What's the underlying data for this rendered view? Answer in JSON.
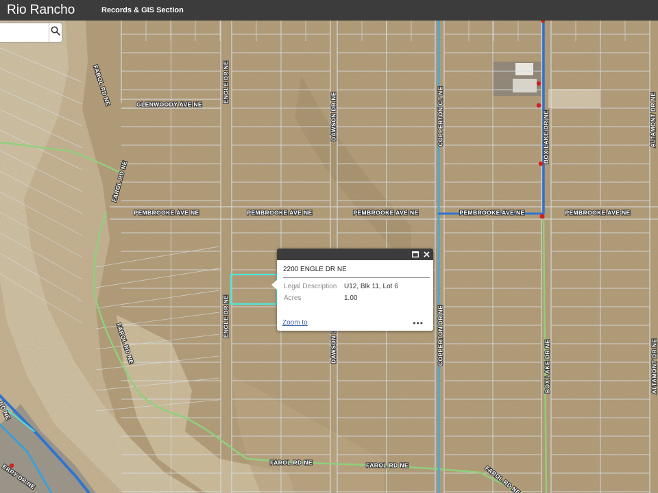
{
  "app": {
    "title": "Rio Rancho",
    "subtitle": "Records & GIS Section"
  },
  "search": {
    "value": "",
    "placeholder": "",
    "button_icon": "search-icon"
  },
  "map": {
    "imagery": "aerial-desert",
    "colors": {
      "parcel_lines": "#d6dde2",
      "road_green": "#8fd07c",
      "utility_blue": "#3a87d8",
      "highlight_cyan": "#4fe6d6",
      "hydrant_red": "#d11f1f"
    },
    "road_labels": [
      "FAROL RD NE",
      "GLENWOODY AVE NE",
      "ENGLE DR NE",
      "DAWSON DR NE",
      "COPPERTON CT NE",
      "BOX LAKE DR NE",
      "ALTAMONT DR NE",
      "FAROL RD NE",
      "PEMBROOKE AVE NE",
      "PEMBROOKE AVE NE",
      "PEMBROOKE AVE NE",
      "PEMBROOKE AVE NE",
      "PEMBROOKE AVE NE",
      "ENGLE DR NE",
      "FAROL RD NE",
      "DAWSON DR NE",
      "COPPERTON DR NE",
      "BOX LAKE DR NE",
      "ALTAMONT DR NE",
      "FAROL RD NE",
      "FAROL RD NE",
      "FAROL RD NE",
      "ERRY DR NE",
      "RD NE"
    ]
  },
  "popup": {
    "title": "2200 ENGLE DR NE",
    "attributes": [
      {
        "name": "Legal Description",
        "value": "U12, Blk 11, Lot 6"
      },
      {
        "name": "Acres",
        "value": "1.00"
      }
    ],
    "zoom_label": "Zoom to",
    "more_label": "•••",
    "maximize_icon": "maximize-icon",
    "close_icon": "close-icon"
  }
}
